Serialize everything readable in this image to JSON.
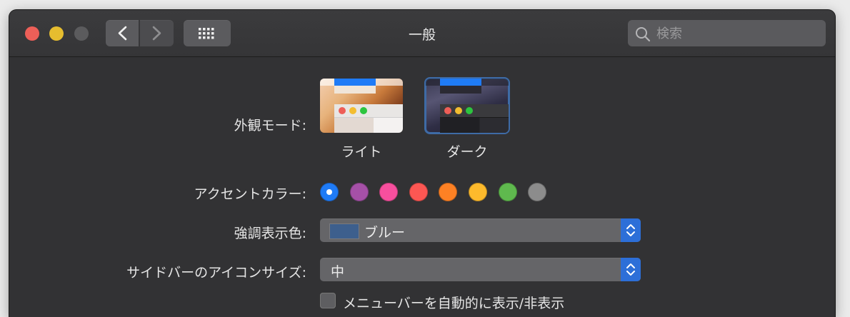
{
  "window": {
    "title": "一般"
  },
  "toolbar": {
    "back_icon": "chevron-left-icon",
    "forward_icon": "chevron-right-icon",
    "grid_icon": "show-all-grid-icon"
  },
  "search": {
    "placeholder": "検索",
    "icon": "magnifier-icon"
  },
  "appearance": {
    "label": "外観モード:",
    "options": [
      {
        "label": "ライト",
        "selected": false
      },
      {
        "label": "ダーク",
        "selected": true
      }
    ]
  },
  "accent": {
    "label": "アクセントカラー:",
    "colors": [
      "#1f7bf6",
      "#a550a7",
      "#f74f9e",
      "#fc5753",
      "#fd8124",
      "#fdba2c",
      "#5fb94e",
      "#8c8c8c"
    ],
    "selected_index": 0
  },
  "highlight": {
    "label": "強調表示色:",
    "value": "ブルー",
    "chip_color": "#3d5f8d"
  },
  "sidebar_icon_size": {
    "label": "サイドバーのアイコンサイズ:",
    "value": "中"
  },
  "menubar_autohide": {
    "label": "メニューバーを自動的に表示/非表示",
    "checked": false
  }
}
